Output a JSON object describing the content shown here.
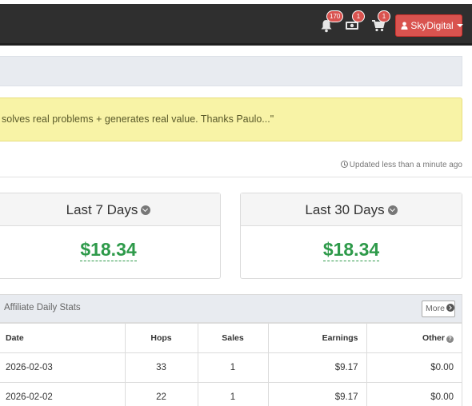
{
  "topbar": {
    "notifications": {
      "icon": "bell-icon",
      "count": "170"
    },
    "money": {
      "icon": "money-icon",
      "count": "1"
    },
    "cart": {
      "icon": "cart-icon",
      "count": "1"
    },
    "user": {
      "icon": "user-icon",
      "name": "SkyDigital"
    }
  },
  "alert": {
    "text": "solves real problems + generates real value. Thanks Paulo...\""
  },
  "status": {
    "updated": "Updated less than a minute ago"
  },
  "stats": [
    {
      "title": "Last 7 Days",
      "value": "$18.34"
    },
    {
      "title": "Last 30 Days",
      "value": "$18.34"
    }
  ],
  "daily": {
    "title": "Affiliate Daily Stats",
    "more_label": "More",
    "columns": [
      "Date",
      "Hops",
      "Sales",
      "Earnings",
      "Other"
    ],
    "rows": [
      [
        "2026-02-03",
        "33",
        "1",
        "$9.17",
        "$0.00"
      ],
      [
        "2026-02-02",
        "22",
        "1",
        "$9.17",
        "$0.00"
      ]
    ]
  },
  "colors": {
    "accent": "#d9534f",
    "positive": "#2e9a4a",
    "alert_bg": "#f8f3a6"
  }
}
